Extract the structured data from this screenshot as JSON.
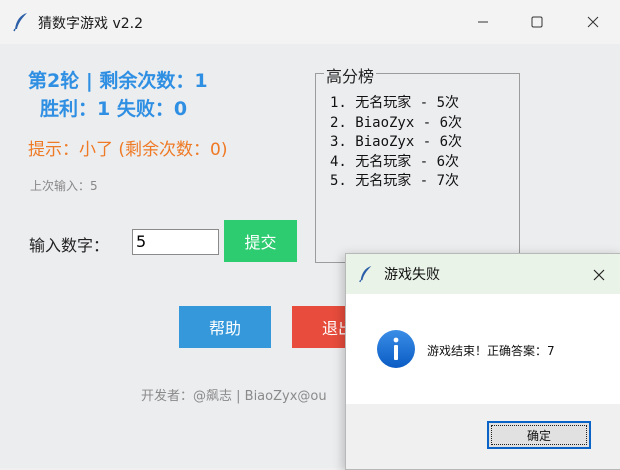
{
  "window": {
    "title": "猜数字游戏 v2.2",
    "icon": "feather-icon"
  },
  "status": {
    "round_line": "第2轮 | 剩余次数：1",
    "win_loss_line": "胜利：1  失败：0",
    "hint": "提示：小了 (剩余次数：0)",
    "last_input": "上次输入：5"
  },
  "input": {
    "label": "输入数字：",
    "value": "5",
    "submit_label": "提交"
  },
  "highscores": {
    "title": "高分榜",
    "entries": [
      "1. 无名玩家 - 5次",
      "2. BiaoZyx - 6次",
      "3. BiaoZyx - 6次",
      "4. 无名玩家 - 6次",
      "5. 无名玩家 - 7次"
    ]
  },
  "actions": {
    "help_label": "帮助",
    "exit_label": "退出"
  },
  "footer": {
    "text": "开发者：@飙志 | BiaoZyx@ou"
  },
  "dialog": {
    "title": "游戏失败",
    "message": "游戏结束！正确答案：7",
    "ok_label": "确定",
    "icon": "info-icon"
  },
  "colors": {
    "accent_blue": "#2f8fe3",
    "hint_orange": "#ef7a25",
    "submit_green": "#2ecc71",
    "help_blue": "#3498db",
    "exit_red": "#e74c3c",
    "dialog_focus": "#0a64c8"
  }
}
